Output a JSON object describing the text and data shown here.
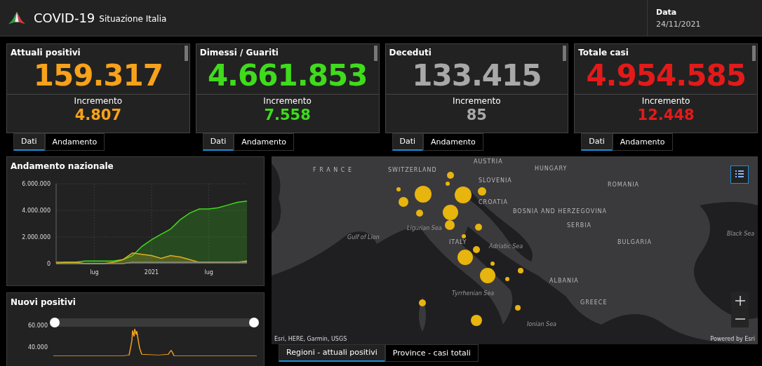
{
  "header": {
    "title": "COVID-19",
    "subtitle": "Situazione Italia",
    "date_label": "Data",
    "date_value": "24/11/2021"
  },
  "cards": [
    {
      "title": "Attuali positivi",
      "value": "159.317",
      "increment_label": "Incremento",
      "increment": "4.807",
      "color": "#f7a21b",
      "tabs": [
        {
          "label": "Dati",
          "selected": true
        },
        {
          "label": "Andamento",
          "selected": false
        }
      ]
    },
    {
      "title": "Dimessi / Guariti",
      "value": "4.661.853",
      "increment_label": "Incremento",
      "increment": "7.558",
      "color": "#3fdb1c",
      "tabs": [
        {
          "label": "Dati",
          "selected": true
        },
        {
          "label": "Andamento",
          "selected": false
        }
      ]
    },
    {
      "title": "Deceduti",
      "value": "133.415",
      "increment_label": "Incremento",
      "increment": "85",
      "color": "#a8a8a8",
      "tabs": [
        {
          "label": "Dati",
          "selected": true
        },
        {
          "label": "Andamento",
          "selected": false
        }
      ]
    },
    {
      "title": "Totale casi",
      "value": "4.954.585",
      "increment_label": "Incremento",
      "increment": "12.448",
      "color": "#e31a1a",
      "tabs": [
        {
          "label": "Dati",
          "selected": true
        },
        {
          "label": "Andamento",
          "selected": false
        }
      ]
    }
  ],
  "trend_panel": {
    "title": "Andamento nazionale",
    "chart_data": {
      "type": "area",
      "categories": [
        null,
        null,
        null,
        null,
        "lug",
        null,
        null,
        null,
        null,
        null,
        "2021",
        null,
        null,
        null,
        null,
        null,
        "lug",
        null,
        null,
        null,
        null
      ],
      "ylim": [
        0,
        6000000
      ],
      "grid": true,
      "yticks": [
        {
          "value": 0,
          "label": "0"
        },
        {
          "value": 2000000,
          "label": "2.000.000"
        },
        {
          "value": 4000000,
          "label": "4.000.000"
        },
        {
          "value": 6000000,
          "label": "6.000.000"
        }
      ],
      "series": [
        {
          "color": "#3fdb1c",
          "values": [
            0,
            100000,
            100000,
            200000,
            200000,
            200000,
            200000,
            300000,
            600000,
            1300000,
            1800000,
            2200000,
            2600000,
            3300000,
            3800000,
            4100000,
            4100000,
            4200000,
            4400000,
            4600000,
            4700000
          ]
        },
        {
          "color": "#e0b020",
          "values": [
            100000,
            100000,
            100000,
            0,
            0,
            0,
            100000,
            300000,
            800000,
            700000,
            600000,
            400000,
            600000,
            500000,
            300000,
            100000,
            100000,
            100000,
            100000,
            100000,
            200000
          ]
        },
        {
          "color": "#8a8a8a",
          "values": [
            0,
            0,
            0,
            0,
            0,
            0,
            0,
            0,
            100000,
            100000,
            100000,
            100000,
            100000,
            100000,
            100000,
            100000,
            100000,
            100000,
            100000,
            100000,
            100000
          ]
        }
      ]
    }
  },
  "new_cases_panel": {
    "title": "Nuovi positivi",
    "y_labels": [
      "60.000",
      "40.000"
    ],
    "range_handles": [
      {
        "level": 0
      },
      {
        "level": 1
      }
    ]
  },
  "map": {
    "labels": [
      {
        "text": "F R A N C E",
        "kind": "country"
      },
      {
        "text": "SWITZERLAND",
        "kind": "country"
      },
      {
        "text": "AUSTRIA",
        "kind": "country"
      },
      {
        "text": "HUNGARY",
        "kind": "country"
      },
      {
        "text": "SLOVENIA",
        "kind": "country"
      },
      {
        "text": "CROATIA",
        "kind": "country"
      },
      {
        "text": "ROMANIA",
        "kind": "country"
      },
      {
        "text": "BOSNIA AND HERZEGOVINA",
        "kind": "country"
      },
      {
        "text": "SERBIA",
        "kind": "country"
      },
      {
        "text": "Ligurian Sea",
        "kind": "sea"
      },
      {
        "text": "Gulf of Lion",
        "kind": "sea"
      },
      {
        "text": "ITALY",
        "kind": "country"
      },
      {
        "text": "Adriatic Sea",
        "kind": "sea"
      },
      {
        "text": "Black Sea",
        "kind": "sea"
      },
      {
        "text": "BULGARIA",
        "kind": "country"
      },
      {
        "text": "ALBANIA",
        "kind": "country"
      },
      {
        "text": "Tyrrhenian Sea",
        "kind": "sea"
      },
      {
        "text": "GREECE",
        "kind": "country"
      },
      {
        "text": "Ionian Sea",
        "kind": "sea"
      }
    ],
    "attribution": "Esri, HERE, Garmin, USGS",
    "powered_by": "Powered by Esri",
    "tabs": [
      {
        "label": "Regioni - attuali positivi",
        "selected": true
      },
      {
        "label": "Province - casi totali",
        "selected": false
      }
    ]
  }
}
